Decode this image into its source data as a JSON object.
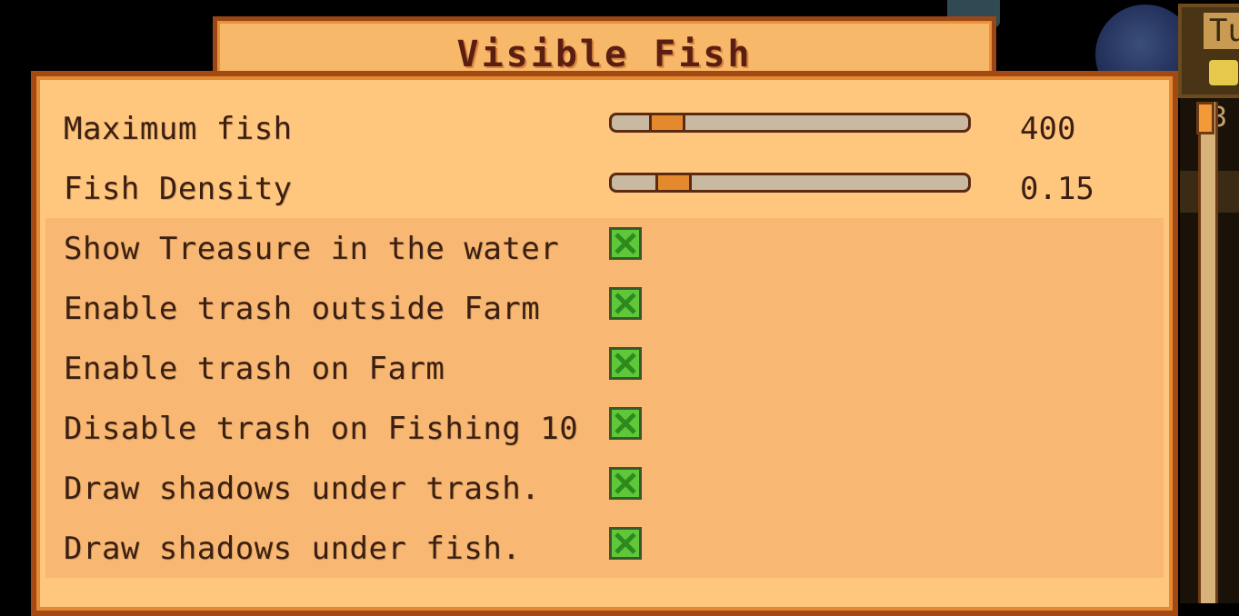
{
  "title": "Visible Fish",
  "hud": {
    "text": "Tu",
    "number": "3"
  },
  "rows": [
    {
      "type": "slider",
      "label": "Maximum fish",
      "value": "400",
      "fill": 0.1
    },
    {
      "type": "slider",
      "label": "Fish Density",
      "value": "0.15",
      "fill": 0.12
    },
    {
      "type": "checkbox",
      "label": "Show Treasure in the water",
      "checked": true
    },
    {
      "type": "checkbox",
      "label": "Enable trash outside Farm",
      "checked": true
    },
    {
      "type": "checkbox",
      "label": "Enable trash on Farm",
      "checked": true
    },
    {
      "type": "checkbox",
      "label": "Disable trash on Fishing 10",
      "checked": true
    },
    {
      "type": "checkbox",
      "label": "Draw shadows under trash.",
      "checked": true
    },
    {
      "type": "checkbox",
      "label": "Draw shadows under fish.",
      "checked": true
    }
  ],
  "colors": {
    "panel_bg": "#ffc67e",
    "panel_border": "#a34a14",
    "checkbox_green": "#5fc83a",
    "slider_handle": "#e48a2c"
  }
}
